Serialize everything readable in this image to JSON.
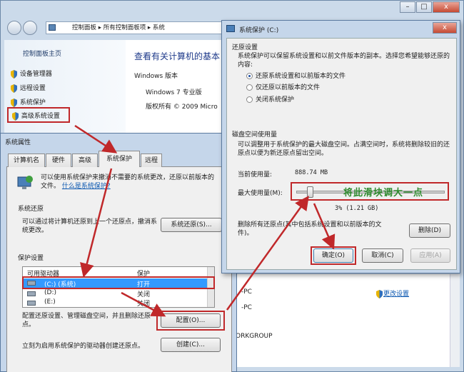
{
  "explorer": {
    "breadcrumb": [
      "控制面板",
      "所有控制面板项",
      "系统"
    ],
    "sidebar_title": "控制面板主页",
    "sidebar_items": [
      "设备管理器",
      "远程设置",
      "系统保护",
      "高级系统设置"
    ],
    "heading": "查看有关计算机的基本",
    "windows_label": "Windows 版本",
    "edition": "Windows 7 专业版",
    "copyright": "版权所有 © 2009 Micro",
    "net_labels": [
      "-PC",
      "-PC",
      "ORKGROUP"
    ],
    "change_settings": "更改设置"
  },
  "sysprops": {
    "title": "系统属性",
    "tabs": [
      "计算机名",
      "硬件",
      "高级",
      "系统保护",
      "远程"
    ],
    "intro": "可以使用系统保护来撤消不需要的系统更改，还原以前版本的文件。",
    "intro_link": "什么是系统保护?",
    "restore_group": "系统还原",
    "restore_desc": "可以通过将计算机还原到上一个还原点，撤消系统更改。",
    "restore_button": "系统还原(S)...",
    "protect_group": "保护设置",
    "col_drive": "可用驱动器",
    "col_protect": "保护",
    "drives": [
      {
        "name": "(C:) (系统)",
        "status": "打开"
      },
      {
        "name": "(D:)",
        "status": "关闭"
      },
      {
        "name": "(E:)",
        "status": "关闭"
      }
    ],
    "config_desc": "配置还原设置、管理磁盘空间，并且删除还原点。",
    "config_button": "配置(O)...",
    "create_desc": "立刻为启用系统保护的驱动器创建还原点。",
    "create_button": "创建(C)..."
  },
  "sysprot": {
    "title": "系统保护 (C:)",
    "close": "x",
    "restore_group": "还原设置",
    "restore_desc": "系统保护可以保留系统设置和以前文件版本的副本。选择您希望能够还原的内容:",
    "options": [
      "还原系统设置和以前版本的文件",
      "仅还原以前版本的文件",
      "关闭系统保护"
    ],
    "disk_group": "磁盘空间使用量",
    "disk_desc": "可以调整用于系统保护的最大磁盘空间。占满空间时，系统将删除较旧的还原点以便为新还原点留出空间。",
    "current_label": "当前使用量:",
    "current_value": "888.74 MB",
    "max_label": "最大使用量(M):",
    "slider_fraction": 0.03,
    "slider_value": "3% (1.21 GB)",
    "annotation": "将此滑块调大一点",
    "delete_desc": "删除所有还原点(其中包括系统设置和以前版本的文件)。",
    "delete_button": "删除(D)",
    "ok": "确定(O)",
    "cancel": "取消(C)",
    "apply": "应用(A)"
  },
  "colors": {
    "highlight": "#3399ff",
    "annotation_red": "#c0282a",
    "annotation_green": "#2e8b2e"
  }
}
